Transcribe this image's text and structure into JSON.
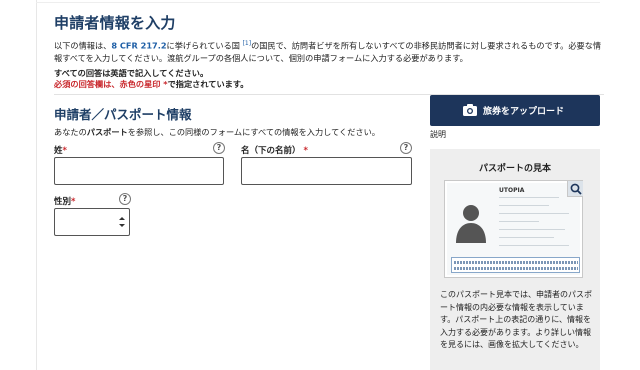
{
  "page": {
    "title": "申請者情報を入力",
    "intro_prefix": "以下の情報は、",
    "intro_cfr": "8 CFR 217.2",
    "intro_middle": "に挙げられている国 ",
    "intro_ref": "[1]",
    "intro_suffix": "の国民で、訪問者ビザを所有しないすべての非移民訪問者に対し要求されるものです。必要な情報すべてを入力してください。渡航グループの各個人について、個別の申請フォームに入力する必要があります。",
    "notice_english": "すべての回答は英語で記入してください。",
    "notice_required_red": "必須の回答欄は、赤色の星印 *",
    "notice_required_rest": "で指定されています。"
  },
  "section": {
    "title": "申請者／パスポート情報",
    "desc_prefix": "あなたの",
    "desc_bold": "パスポート",
    "desc_suffix": "を参照し、この同様のフォームにすべての情報を入力してください。"
  },
  "fields": {
    "surname_label": "姓",
    "given_name_label": "名（下の名前）",
    "gender_label": "性別",
    "required_mark": "*",
    "help_glyph": "?",
    "surname_value": "",
    "given_name_value": "",
    "gender_value": ""
  },
  "sidebar": {
    "upload_label": "旅券をアップロード",
    "explain_link": "説明",
    "sample_title": "パスポートの見本",
    "sample_country": "UTOPIA",
    "sample_text": "このパスポート見本では、申請者のパスポート情報の内必要な情報を表示しています。パスポート上の表記の通りに、情報を入力する必要があります。より詳しい情報を見るには、画像を拡大してください。"
  },
  "icons": {
    "camera": "camera-icon",
    "help": "question-circle-icon",
    "zoom": "magnifier-icon",
    "select": "select-arrows-icon"
  },
  "colors": {
    "heading": "#1f3f66",
    "link": "#1f5fa6",
    "required": "#c9282d",
    "button": "#1d355b",
    "panel": "#eeeeee"
  }
}
